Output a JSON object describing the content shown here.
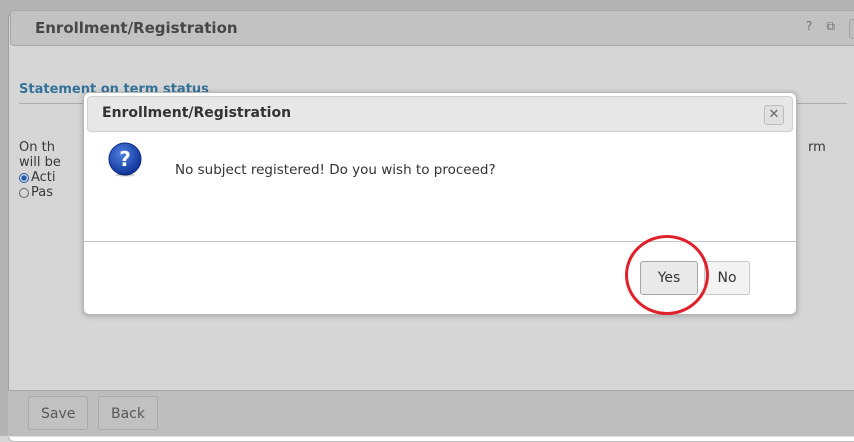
{
  "background_window": {
    "title": "Enrollment/Registration",
    "tools": [
      "?",
      "⧉",
      "✕"
    ],
    "section_title": "Statement on term status",
    "body_left_lines": [
      "On th",
      "will be"
    ],
    "body_right_text": "rm",
    "radio_options": [
      {
        "label": "Acti",
        "checked": true
      },
      {
        "label": "Pas",
        "checked": false
      }
    ],
    "footer_buttons": {
      "save": "Save",
      "back": "Back"
    }
  },
  "dialog": {
    "title": "Enrollment/Registration",
    "close_glyph": "✕",
    "icon": "question-icon",
    "message": "No subject registered! Do you wish to proceed?",
    "buttons": {
      "yes": "Yes",
      "no": "No"
    }
  },
  "colors": {
    "section_title": "#3f88b8",
    "question_icon": "#1a3fa6",
    "highlight": "#e0202a"
  }
}
